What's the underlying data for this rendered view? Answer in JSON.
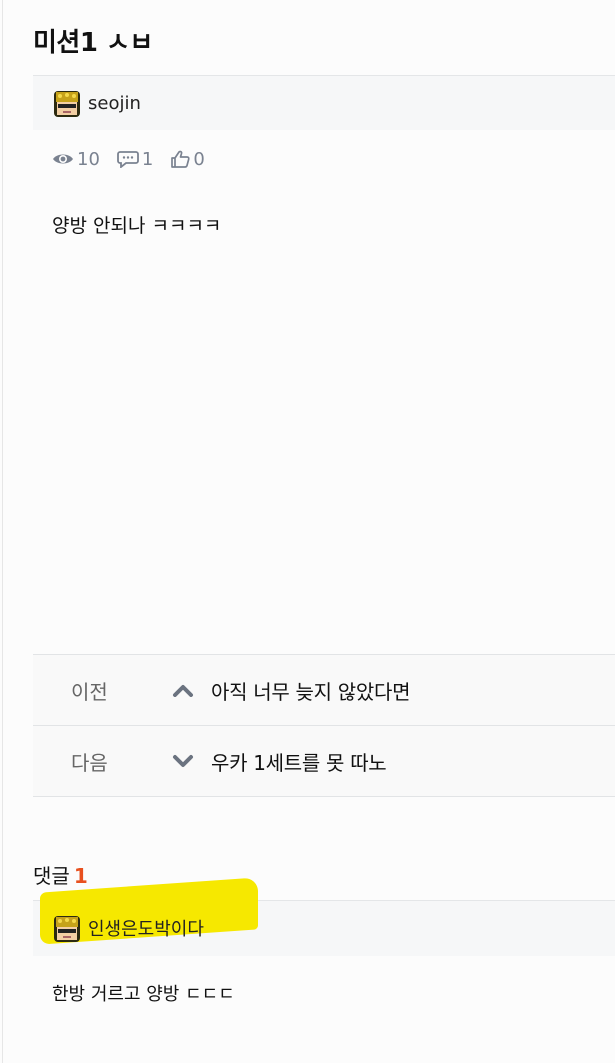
{
  "post": {
    "title": "미션1 ㅅㅂ",
    "author": "seojin",
    "views": "10",
    "comments": "1",
    "likes": "0",
    "body": "양방 안되나 ㅋㅋㅋㅋ"
  },
  "navigation": {
    "prev_label": "이전",
    "prev_title": "아직 너무 늦지 않았다면",
    "next_label": "다음",
    "next_title": "우카 1세트를 못 따노"
  },
  "comments": {
    "heading": "댓글",
    "count": "1",
    "items": [
      {
        "author": "인생은도박이다",
        "text": "한방 거르고 양방 ㄷㄷㄷ"
      }
    ]
  },
  "icons": {
    "views": "eye-icon",
    "comments": "speech-bubble-icon",
    "likes": "thumbs-up-icon",
    "prev": "chevron-up-icon",
    "next": "chevron-down-icon"
  },
  "colors": {
    "accent_count": "#e8501e",
    "highlight": "#f6e800",
    "meta_gray": "#7a8290"
  }
}
